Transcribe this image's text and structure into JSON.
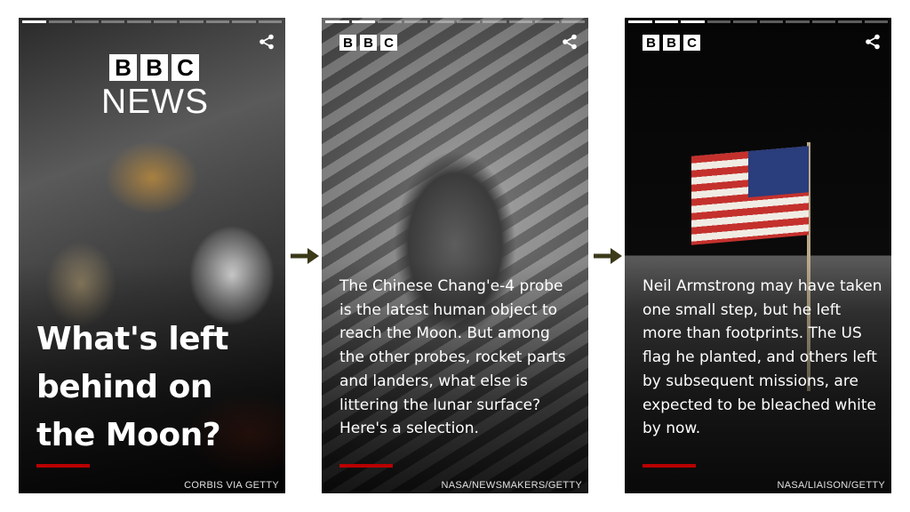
{
  "accent_color": "#b80000",
  "arrow_color": "#3b3a1b",
  "cards": [
    {
      "progress_total": 10,
      "progress_active": 1,
      "logo_letters": [
        "B",
        "B",
        "C"
      ],
      "logo_word": "NEWS",
      "headline": "What's left behind on the Moon?",
      "credit": "CORBIS VIA GETTY",
      "share_icon": "share-icon"
    },
    {
      "progress_total": 10,
      "progress_active": 2,
      "logo_letters": [
        "B",
        "B",
        "C"
      ],
      "body": "The Chinese Chang'e-4 probe is the latest human object to reach the Moon. But among the other probes, rocket parts and landers, what else is littering the lunar surface? Here's a selection.",
      "credit": "NASA/NEWSMAKERS/GETTY",
      "share_icon": "share-icon"
    },
    {
      "progress_total": 10,
      "progress_active": 3,
      "logo_letters": [
        "B",
        "B",
        "C"
      ],
      "body": "Neil Armstrong may have taken one small step, but he left more than footprints. The US flag he planted, and others left by subsequent missions, are expected to be bleached white by now.",
      "credit": "NASA/LIAISON/GETTY",
      "share_icon": "share-icon"
    }
  ]
}
